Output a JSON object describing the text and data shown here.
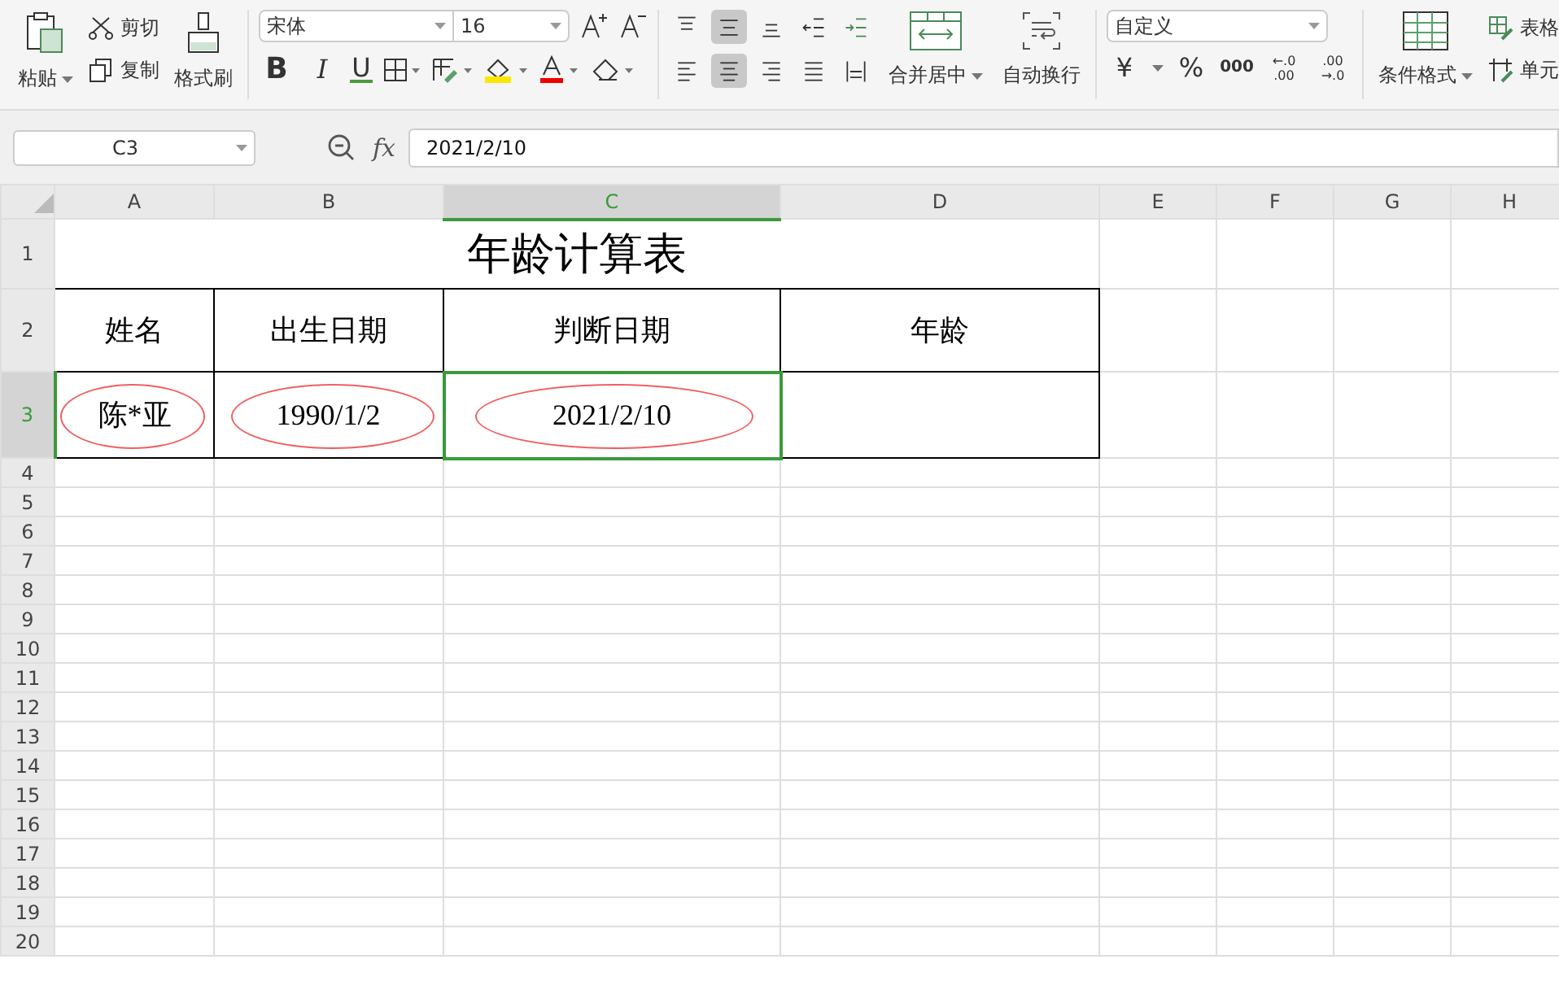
{
  "toolbar": {
    "paste": "粘贴",
    "cut": "剪切",
    "copy": "复制",
    "format_painter": "格式刷",
    "font_name": "宋体",
    "font_size": "16",
    "bold": "B",
    "italic": "I",
    "underline": "U",
    "align_buttons": [
      {
        "kind": "top",
        "selected": false
      },
      {
        "kind": "middle",
        "selected": true
      },
      {
        "kind": "bottom",
        "selected": false
      },
      {
        "kind": "outdent",
        "selected": false
      },
      {
        "kind": "indent",
        "selected": false
      },
      {
        "kind": "left",
        "selected": false
      },
      {
        "kind": "center",
        "selected": true
      },
      {
        "kind": "right",
        "selected": false
      },
      {
        "kind": "justify",
        "selected": false
      },
      {
        "kind": "distributed",
        "selected": false
      }
    ],
    "merge": "合并居中",
    "wrap": "自动换行",
    "number_format": "自定义",
    "currency": "¥",
    "percent": "%",
    "thousands": "000",
    "decimal_increase": {
      "top": "←.0",
      "bottom": ".00"
    },
    "decimal_decrease": {
      "top": ".00",
      "bottom": "→.0"
    },
    "conditional_format": "条件格式",
    "table_style": "表格",
    "cell_style": "单元"
  },
  "formula_bar": {
    "name_box": "C3",
    "fx": "fx",
    "value": "2021/2/10"
  },
  "sheet": {
    "columns": [
      {
        "label": "A",
        "selected": false
      },
      {
        "label": "B",
        "selected": false
      },
      {
        "label": "C",
        "selected": true
      },
      {
        "label": "D",
        "selected": false
      },
      {
        "label": "E",
        "selected": false
      },
      {
        "label": "F",
        "selected": false
      },
      {
        "label": "G",
        "selected": false
      },
      {
        "label": "H",
        "selected": false
      }
    ],
    "rows": [
      {
        "label": "1",
        "selected": false
      },
      {
        "label": "2",
        "selected": false
      },
      {
        "label": "3",
        "selected": true
      },
      {
        "label": "4",
        "selected": false
      },
      {
        "label": "5",
        "selected": false
      },
      {
        "label": "6",
        "selected": false
      },
      {
        "label": "7",
        "selected": false
      },
      {
        "label": "8",
        "selected": false
      },
      {
        "label": "9",
        "selected": false
      },
      {
        "label": "10",
        "selected": false
      },
      {
        "label": "11",
        "selected": false
      },
      {
        "label": "12",
        "selected": false
      },
      {
        "label": "13",
        "selected": false
      },
      {
        "label": "14",
        "selected": false
      },
      {
        "label": "15",
        "selected": false
      },
      {
        "label": "16",
        "selected": false
      },
      {
        "label": "17",
        "selected": false
      },
      {
        "label": "18",
        "selected": false
      },
      {
        "label": "19",
        "selected": false
      },
      {
        "label": "20",
        "selected": false
      }
    ],
    "title": "年龄计算表",
    "header_row": [
      "姓名",
      "出生日期",
      "判断日期",
      "年龄"
    ],
    "data_row": [
      {
        "value": "陈*亚",
        "circled": true,
        "active": false
      },
      {
        "value": "1990/1/2",
        "circled": true,
        "active": false
      },
      {
        "value": "2021/2/10",
        "circled": true,
        "active": true
      },
      {
        "circled": false,
        "active": false
      }
    ]
  }
}
